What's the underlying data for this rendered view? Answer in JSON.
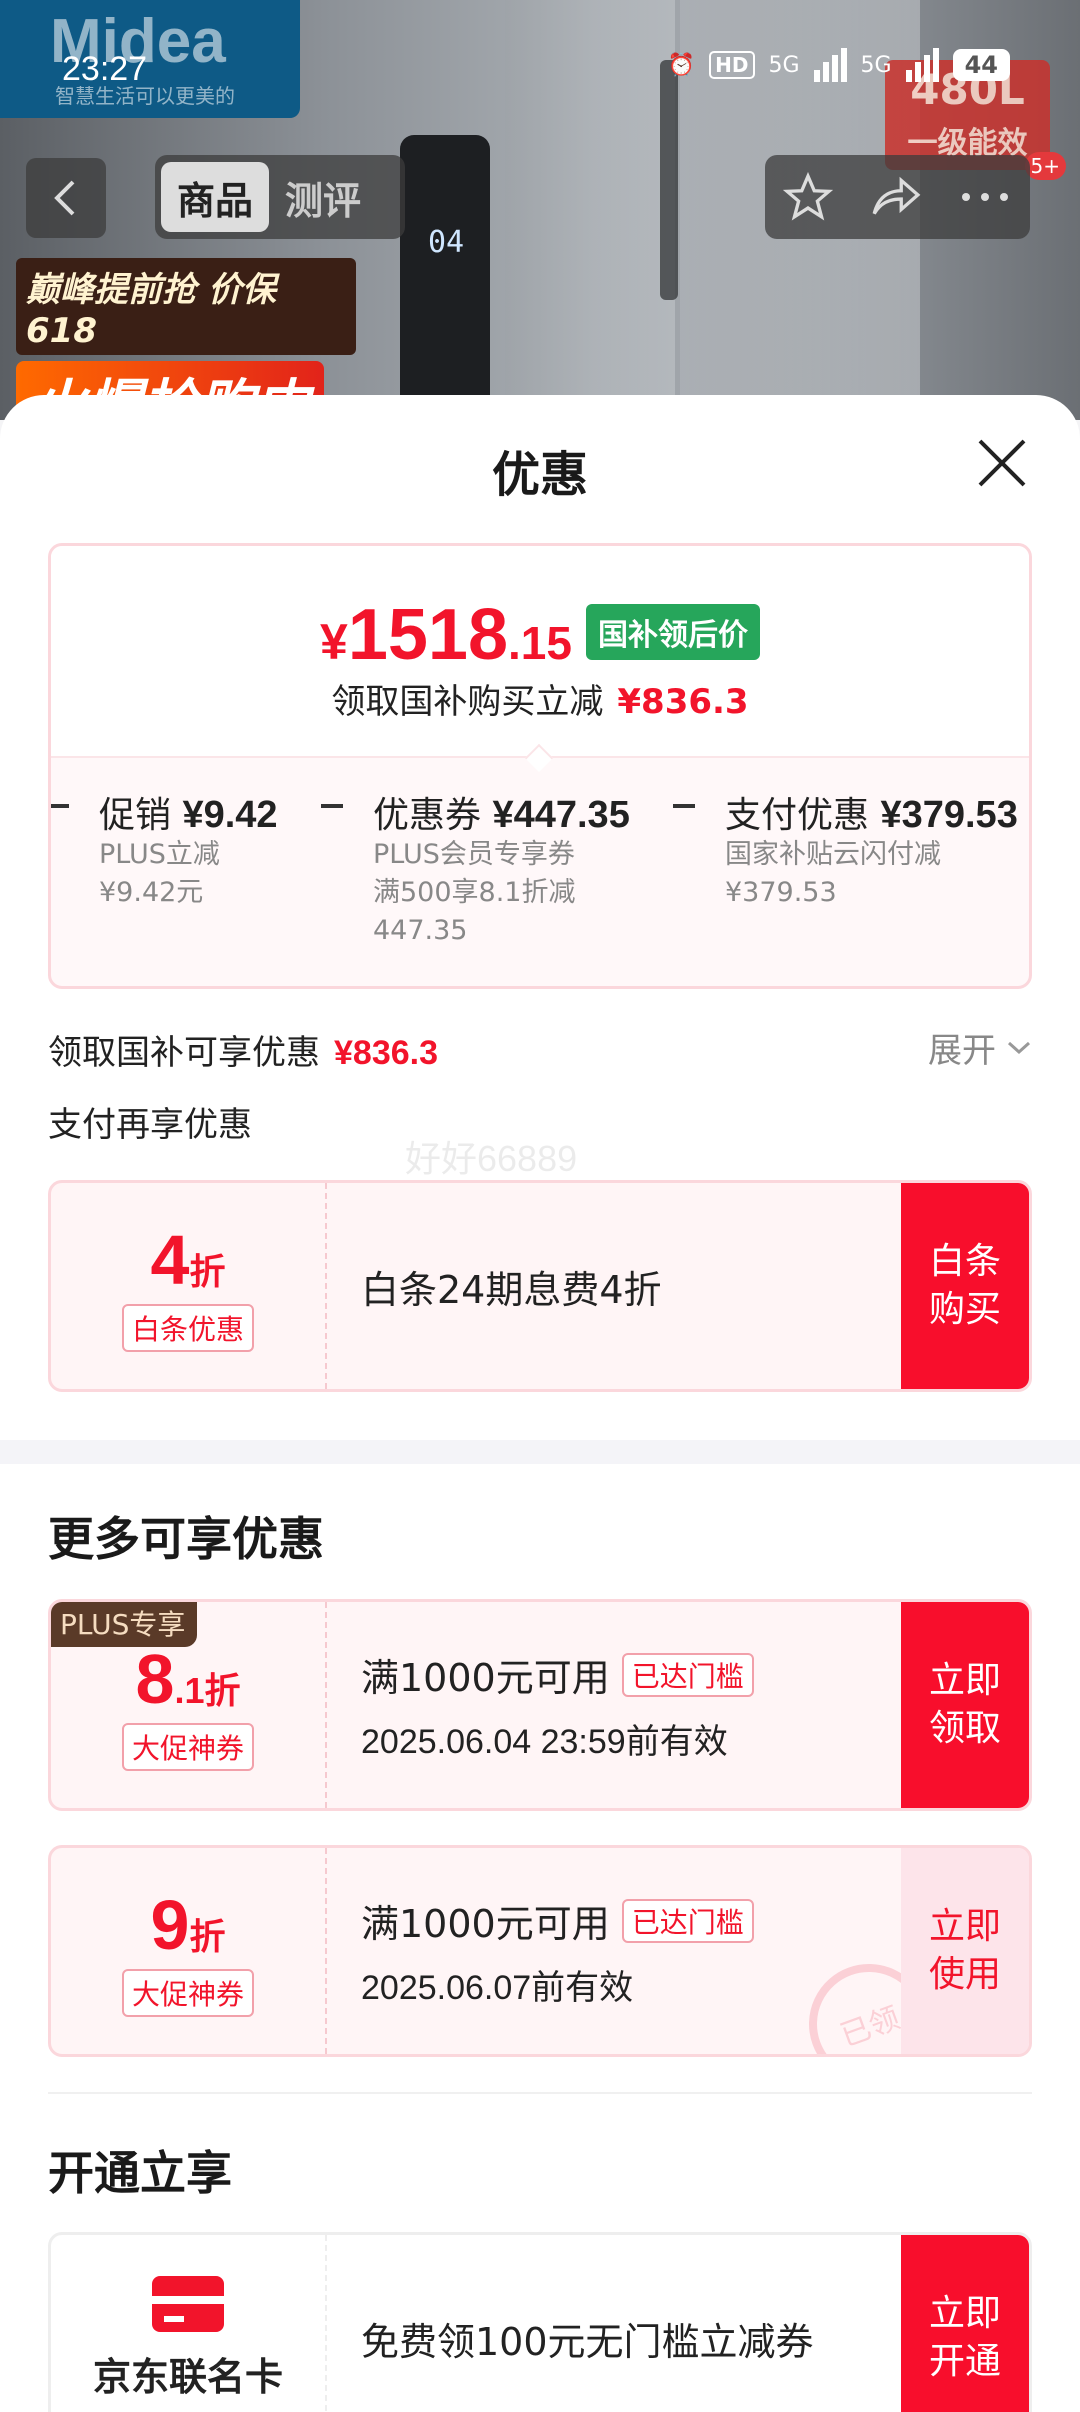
{
  "status_bar": {
    "time": "23:27",
    "hd": "HD",
    "net1": "5G",
    "net2": "5G",
    "battery": "44"
  },
  "product_header": {
    "brand": "Midea",
    "slogan": "智慧生活可以更美的",
    "capacity": "480L",
    "energy": "一级能效",
    "badge": "5+",
    "promo_line1": "巅峰提前抢 价保618",
    "promo_line2": "火爆抢购中",
    "panel_display": "04"
  },
  "nav": {
    "tabs": [
      "商品",
      "测评"
    ],
    "active_tab": 0
  },
  "sheet": {
    "title": "优惠",
    "price": {
      "yen": "¥",
      "integer": "1518",
      "decimal": ".15",
      "tag": "国补领后价"
    },
    "price_sub": {
      "text": "领取国补购买立减",
      "amount": "¥836.3"
    },
    "discounts": [
      {
        "title": "促销",
        "amount": "¥9.42",
        "desc": [
          "PLUS立减",
          "¥9.42元"
        ]
      },
      {
        "title": "优惠券",
        "amount": "¥447.35",
        "desc": [
          "PLUS会员专享券",
          "满500享8.1折减",
          "447.35"
        ]
      },
      {
        "title": "支付优惠",
        "amount": "¥379.53",
        "desc": [
          "国家补贴云闪付减",
          "¥379.53"
        ]
      }
    ],
    "subsidy_line": {
      "text": "领取国补可享优惠",
      "amount": "¥836.3",
      "expand": "展开"
    },
    "pay_more_title": "支付再享优惠",
    "watermark": "好好66889",
    "baitiao": {
      "discount_num": "4",
      "discount_unit": "折",
      "tag": "白条优惠",
      "text": "白条24期息费4折",
      "button": [
        "白条",
        "购买"
      ]
    },
    "more_title": "更多可享优惠",
    "coupons": [
      {
        "plus_tag": "PLUS专享",
        "num": "8",
        "dec": ".1",
        "unit": "折",
        "tag": "大促神券",
        "condition": "满1000元可用",
        "reach": "已达门槛",
        "valid": "2025.06.04 23:59前有效",
        "button": [
          "立即",
          "领取"
        ]
      },
      {
        "num": "9",
        "dec": "",
        "unit": "折",
        "tag": "大促神券",
        "condition": "满1000元可用",
        "reach": "已达门槛",
        "valid": "2025.06.07前有效",
        "button": [
          "立即",
          "使用"
        ],
        "stamp": "已领"
      }
    ],
    "open_title": "开通立享",
    "card": {
      "name": "京东联名卡",
      "text": "免费领100元无门槛立减券",
      "button": [
        "立即",
        "开通"
      ]
    }
  },
  "colors": {
    "accent_red": "#f2142b",
    "button_red": "#f80e2c",
    "green_tag": "#26a65b"
  }
}
